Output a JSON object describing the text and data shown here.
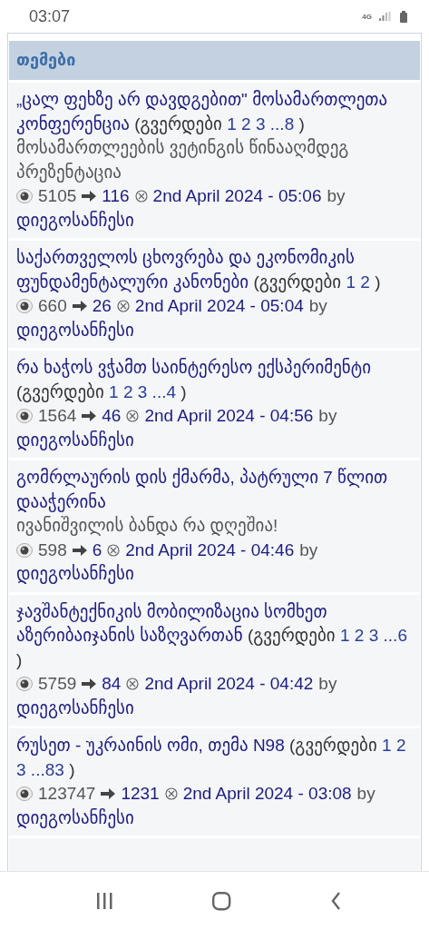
{
  "status_bar": {
    "time": "03:07",
    "network": "4G"
  },
  "section": {
    "title": "თემები"
  },
  "topics": [
    {
      "title": "„ცალ ფეხზე არ დავდგებით\" მოსამართლეთა კონფერენცია",
      "pages_label": "(გვერდები",
      "pages": [
        "1",
        "2",
        "3",
        "...8"
      ],
      "pages_close": ")",
      "description": "მოსამართლეების ვეტინგის წინააღმდეგ პრეზენტაცია",
      "views": "5105",
      "replies": "116",
      "date": "2nd April 2024 - 05:06",
      "by": "by",
      "author": "დიეგოსანჩესი"
    },
    {
      "title": "საქართველოს ცხოვრება და ეკონომიკის ფუნდამენტალური კანონები",
      "pages_label": "(გვერდები",
      "pages": [
        "1",
        "2"
      ],
      "pages_close": ")",
      "views": "660",
      "replies": "26",
      "date": "2nd April 2024 - 05:04",
      "by": "by",
      "author": "დიეგოსანჩესი"
    },
    {
      "title": "რა ხაჭოს ვჭამთ საინტერესო ექსპერიმენტი",
      "pages_label": "(გვერდები",
      "pages": [
        "1",
        "2",
        "3",
        "...4"
      ],
      "pages_close": ")",
      "views": "1564",
      "replies": "46",
      "date": "2nd April 2024 - 04:56",
      "by": "by",
      "author": "დიეგოსანჩესი"
    },
    {
      "title": "გომრლაურის დის ქმარმა, პატრული 7 წლით დააჭერინა",
      "description": "ივანიშვილის ბანდა რა დღეშია!",
      "views": "598",
      "replies": "6",
      "date": "2nd April 2024 - 04:46",
      "by": "by",
      "author": "დიეგოსანჩესი"
    },
    {
      "title": "ჯავშანტექნიკის მობილიზაცია სომხეთ აზერიბაიჯანის საზღვართან",
      "pages_label": "(გვერდები",
      "pages": [
        "1",
        "2",
        "3",
        "...6"
      ],
      "pages_close": ")",
      "views": "5759",
      "replies": "84",
      "date": "2nd April 2024 - 04:42",
      "by": "by",
      "author": "დიეგოსანჩესი"
    },
    {
      "title": "რუსეთ - უკრაინის ომი, თემა N98",
      "pages_label": "(გვერდები",
      "pages": [
        "1",
        "2",
        "3",
        "...83"
      ],
      "pages_close": ")",
      "views": "123747",
      "replies": "1231",
      "date": "2nd April 2024 - 03:08",
      "by": "by",
      "author": "დიეგოსანჩესი"
    }
  ]
}
